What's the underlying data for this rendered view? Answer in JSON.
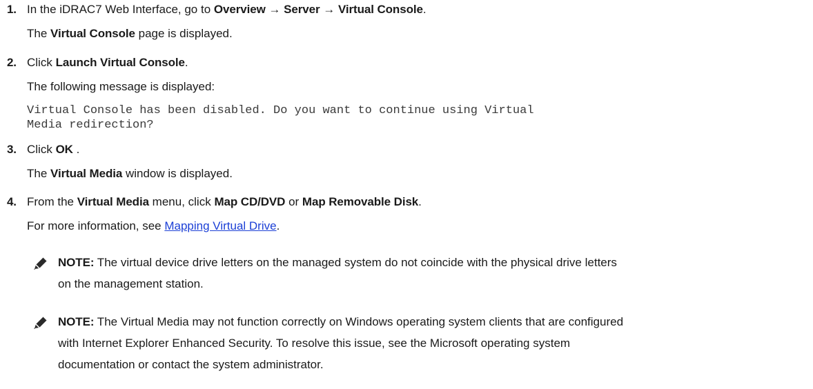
{
  "steps": [
    {
      "number": "1.",
      "line1": {
        "pre": "In the iDRAC7 Web Interface, go to ",
        "b1": "Overview",
        "arrow1": " → ",
        "b2": "Server",
        "arrow2": " → ",
        "b3": "Virtual Console",
        "post": "."
      },
      "line2": {
        "pre": "The ",
        "b1": "Virtual Console",
        "post": " page is displayed."
      }
    },
    {
      "number": "2.",
      "line1": {
        "pre": "Click ",
        "b1": "Launch Virtual Console",
        "post": "."
      },
      "line2": "The following message is displayed:",
      "message_line1": "Virtual Console has been disabled. Do you want to continue using Virtual",
      "message_line2": "Media redirection?"
    },
    {
      "number": "3.",
      "line1": {
        "pre": "Click ",
        "b1": "OK",
        "post": " ."
      },
      "line2": {
        "pre": "The ",
        "b1": "Virtual Media",
        "post": " window is displayed."
      }
    },
    {
      "number": "4.",
      "line1": {
        "pre": "From the ",
        "b1": "Virtual Media",
        "mid1": " menu, click ",
        "b2": "Map CD/DVD",
        "mid2": " or ",
        "b3": "Map Removable Disk",
        "post": "."
      },
      "line2": {
        "pre": "For more information, see ",
        "link": "Mapping Virtual Drive",
        "post": "."
      }
    }
  ],
  "notes": [
    {
      "label": "NOTE:",
      "line1": " The virtual device drive letters on the managed system do not coincide with the physical drive letters",
      "line2": "on the management station."
    },
    {
      "label": "NOTE:",
      "line1": " The Virtual Media may not function correctly on Windows operating system clients that are configured",
      "line2": "with Internet Explorer Enhanced Security. To resolve this issue, see the Microsoft operating system",
      "line3": "documentation or contact the system administrator."
    }
  ],
  "icon": "note-pencil-icon",
  "colors": {
    "text": "#1a1a1a",
    "link": "#1b3fd6",
    "mono": "#3a3a3a"
  }
}
